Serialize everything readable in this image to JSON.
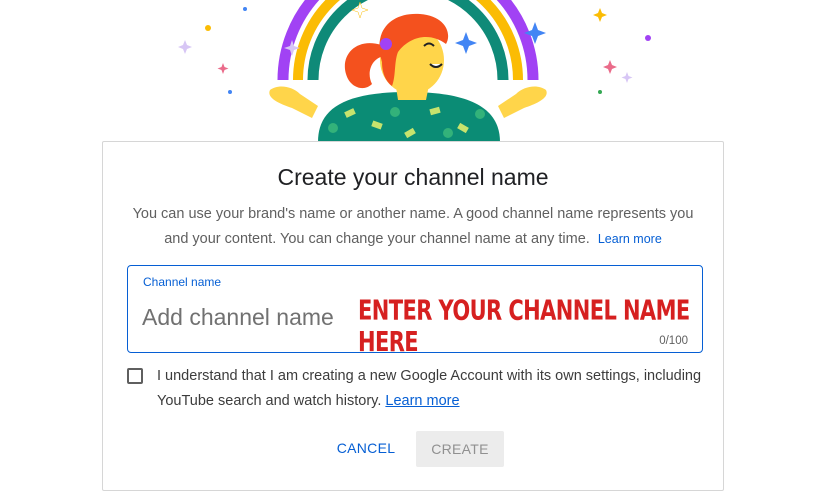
{
  "dialog": {
    "title": "Create your channel name",
    "description": "You can use your brand's name or another name. A good channel name represents you and your content. You can change your channel name at any time.",
    "learn_more_inline": "Learn more"
  },
  "channel_field": {
    "label": "Channel name",
    "value": "",
    "placeholder": "Add channel name",
    "counter": "0/100",
    "annotation": "ENTER YOUR CHANNEL NAME HERE"
  },
  "consent": {
    "text": "I understand that I am creating a new Google Account with its own settings, including YouTube search and watch history.",
    "learn_more": "Learn more",
    "checked": false
  },
  "buttons": {
    "cancel": "CANCEL",
    "create": "CREATE"
  },
  "colors": {
    "accent": "#065fd4",
    "annotation": "#d62020",
    "disabled_bg": "#ececec",
    "disabled_text": "#909090"
  }
}
